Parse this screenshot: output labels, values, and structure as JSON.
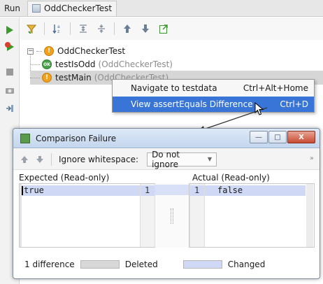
{
  "run_header": {
    "label": "Run",
    "tab_title": "OddCheckerTest"
  },
  "left_toolbar": {
    "icons": [
      "rerun-icon",
      "rerun-failed-icon",
      "stop-icon",
      "camera-icon",
      "restore-layout-icon"
    ]
  },
  "main_toolbar": {
    "icons": [
      "filter-failed-icon",
      "sort-alpha-icon",
      "expand-all-icon",
      "collapse-all-icon",
      "previous-failed-icon",
      "next-failed-icon",
      "export-icon"
    ]
  },
  "tree": {
    "root": {
      "label": "OddCheckerTest"
    },
    "children": [
      {
        "name": "testIsOdd",
        "suite": "(OddCheckerTest)",
        "status": "OK"
      },
      {
        "name": "testMain",
        "suite": "(OddCheckerTest)",
        "status": "!"
      }
    ]
  },
  "context_menu": {
    "items": [
      {
        "label": "Navigate to testdata",
        "shortcut": "Ctrl+Alt+Home"
      },
      {
        "label": "View assertEquals Difference",
        "shortcut": "Ctrl+D"
      }
    ]
  },
  "dialog": {
    "title": "Comparison Failure",
    "window_buttons": [
      "—",
      "□",
      "X"
    ],
    "toolbar": {
      "ignore_whitespace_label": "Ignore whitespace:",
      "ignore_whitespace_value": "Do not ignore",
      "more": "»"
    },
    "expected": {
      "label": "Expected (Read-only)",
      "text": "true",
      "line": "1"
    },
    "actual": {
      "label": "Actual (Read-only)",
      "text": "false",
      "line": "1"
    },
    "legend": {
      "count": "1 difference",
      "deleted": "Deleted",
      "changed": "Changed"
    }
  },
  "colors": {
    "selection": "#3875d7",
    "changed": "#cfd9f5",
    "deleted": "#d8d8d8",
    "warning": "#f0a21e",
    "ok": "#4aa24a"
  }
}
